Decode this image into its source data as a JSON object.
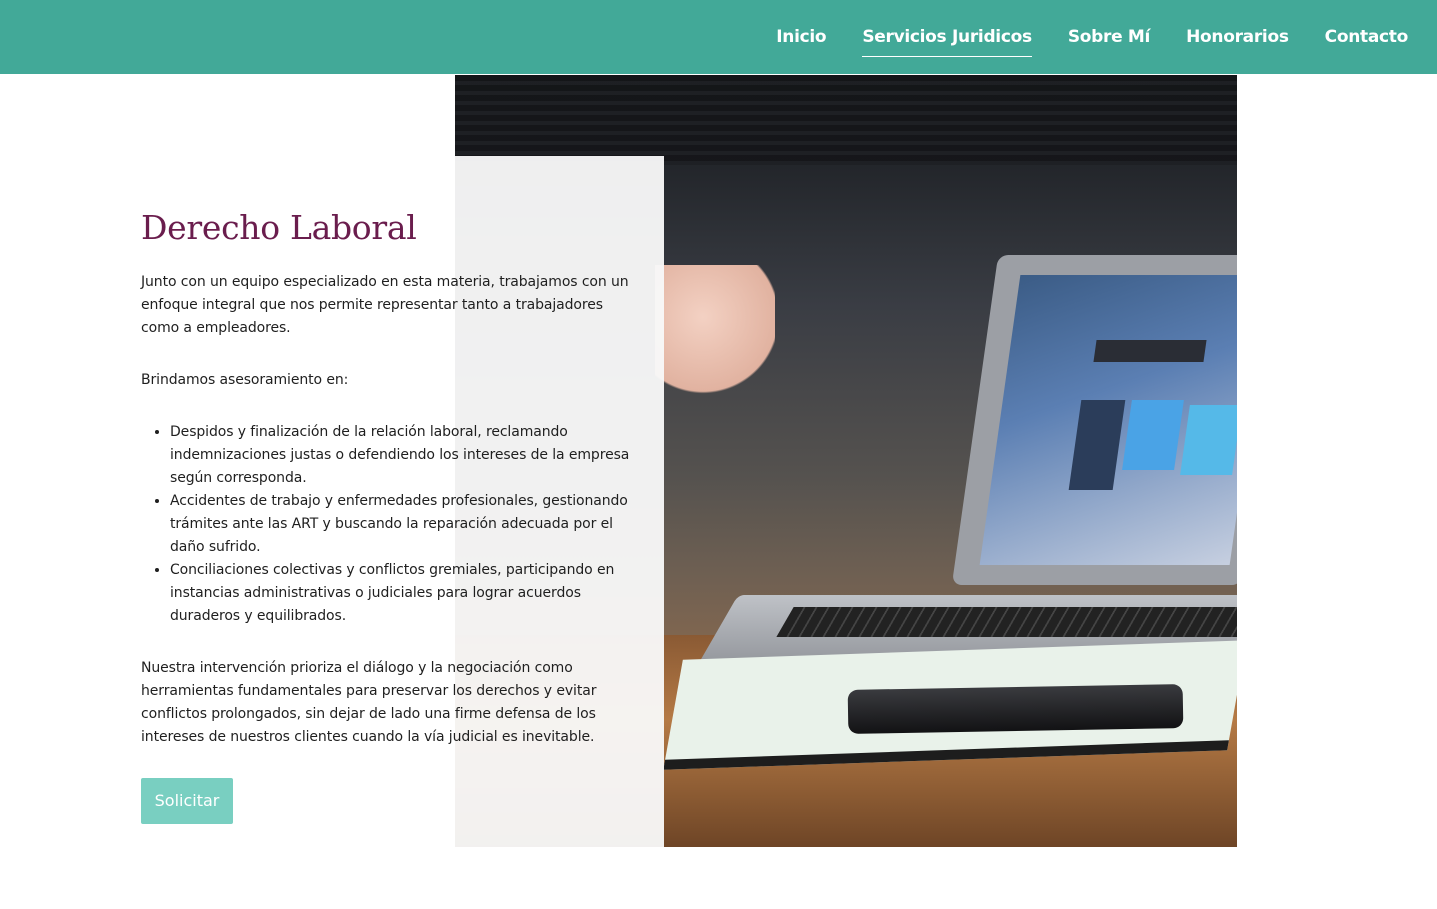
{
  "nav": {
    "items": [
      {
        "label": "Inicio",
        "active": false
      },
      {
        "label": "Servicios Juridicos",
        "active": true
      },
      {
        "label": "Sobre Mí",
        "active": false
      },
      {
        "label": "Honorarios",
        "active": false
      },
      {
        "label": "Contacto",
        "active": false
      }
    ]
  },
  "colors": {
    "header": "#42a998",
    "title": "#6a1d4d",
    "button": "#79cfc1"
  },
  "main": {
    "title": "Derecho Laboral",
    "intro": "Junto con un equipo especializado en esta materia, trabajamos con un enfoque integral que nos permite representar tanto a trabajadores como a empleadores.",
    "subheading": "Brindamos asesoramiento en:",
    "services": [
      "Despidos y finalización de la relación laboral, reclamando indemnizaciones justas o defendiendo los intereses de la empresa según corresponda.",
      "Accidentes de trabajo y enfermedades profesionales, gestionando trámites ante las ART y buscando la reparación adecuada por el daño sufrido.",
      "Conciliaciones colectivas y conflictos gremiales, participando en instancias administrativas o judiciales para lograr acuerdos duraderos y equilibrados."
    ],
    "closing": "Nuestra intervención prioriza el diálogo y la negociación como herramientas fundamentales para preservar los derechos y evitar conflictos prolongados, sin dejar de lado una firme defensa de los intereses de nuestros clientes cuando la vía judicial es inevitable.",
    "button_label": "Solicitar"
  }
}
